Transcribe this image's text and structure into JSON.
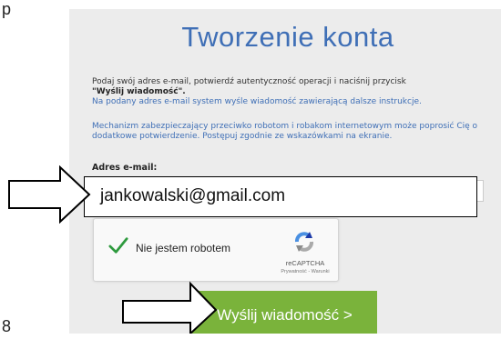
{
  "page_marks": {
    "top": "p",
    "bottom": "8"
  },
  "form": {
    "title": "Tworzenie konta",
    "instruction_1": "Podaj swój adres e-mail, potwierdź autentyczność operacji i naciśnij przycisk",
    "instruction_1_bold": "\"Wyślij wiadomość\".",
    "instruction_2": "Na podany adres e-mail system wyśle wiadomość zawierającą dalsze instrukcje.",
    "instruction_3": "Mechanizm zabezpieczający przeciwko robotom i robakom internetowym może poprosić Cię o dodatkowe potwierdzenie. Postępuj zgodnie ze wskazówkami na ekranie.",
    "email_label": "Adres e-mail:",
    "email_value": "jankowalski@gmail.com",
    "submit_label": "Wyślij wiadomość >"
  },
  "recaptcha": {
    "label": "Nie jestem robotem",
    "brand": "reCAPTCHA",
    "terms": "Prywatność - Warunki",
    "checked": true
  },
  "colors": {
    "panel_bg": "#ececec",
    "title": "#3f6fb6",
    "info_text": "#3f6fb6",
    "button": "#7ab33b",
    "check": "#2e9a3e"
  },
  "icons": [
    "checkmark-icon",
    "recaptcha-logo-icon",
    "arrow-icon"
  ]
}
